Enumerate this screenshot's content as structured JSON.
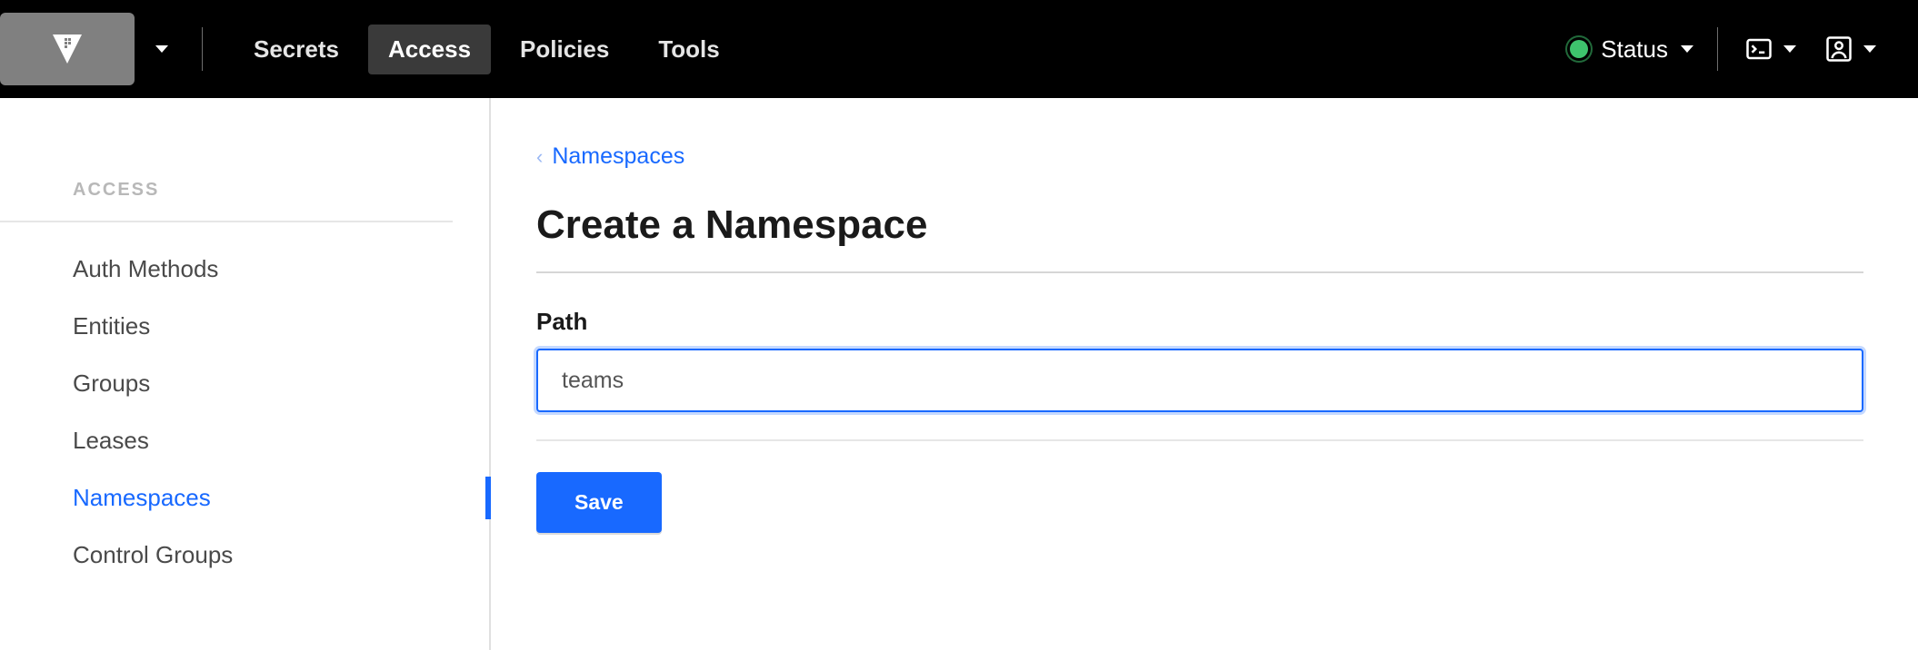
{
  "topnav": {
    "tabs": [
      {
        "label": "Secrets",
        "active": false
      },
      {
        "label": "Access",
        "active": true
      },
      {
        "label": "Policies",
        "active": false
      },
      {
        "label": "Tools",
        "active": false
      }
    ],
    "status_label": "Status"
  },
  "sidebar": {
    "heading": "ACCESS",
    "items": [
      {
        "label": "Auth Methods",
        "active": false
      },
      {
        "label": "Entities",
        "active": false
      },
      {
        "label": "Groups",
        "active": false
      },
      {
        "label": "Leases",
        "active": false
      },
      {
        "label": "Namespaces",
        "active": true
      },
      {
        "label": "Control Groups",
        "active": false
      }
    ]
  },
  "main": {
    "breadcrumb_label": "Namespaces",
    "page_title": "Create a Namespace",
    "field_label": "Path",
    "path_value": "teams",
    "save_label": "Save"
  }
}
